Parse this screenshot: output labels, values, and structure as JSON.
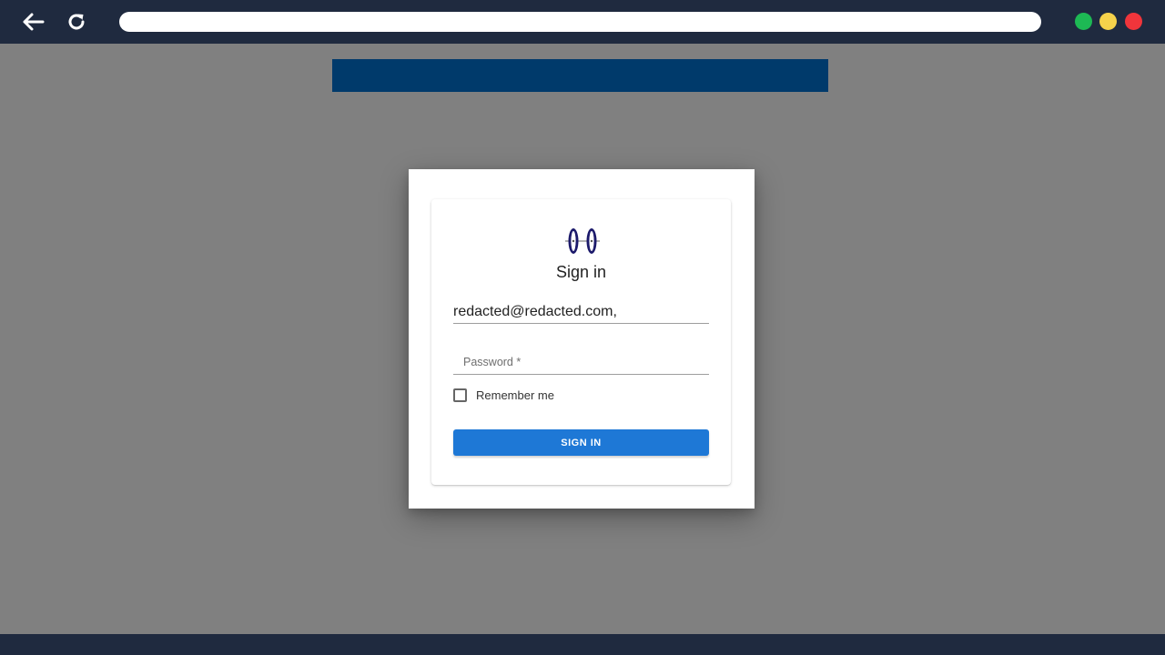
{
  "browser": {
    "address_url": "",
    "window_controls": {
      "green": "#1db954",
      "yellow": "#f5d24b",
      "red": "#f0353b"
    },
    "icons": {
      "back": "arrow-left-icon",
      "reload": "reload-icon"
    }
  },
  "colors": {
    "chrome": "#1f2a3f",
    "backdrop": "#808080",
    "banner": "#003a6b",
    "accent": "#1e78d6"
  },
  "signin": {
    "title": "Sign in",
    "email_value": "redacted@redacted.com,",
    "password_placeholder": "Password *",
    "remember_label": "Remember me",
    "remember_checked": false,
    "submit_label": "SIGN IN"
  }
}
